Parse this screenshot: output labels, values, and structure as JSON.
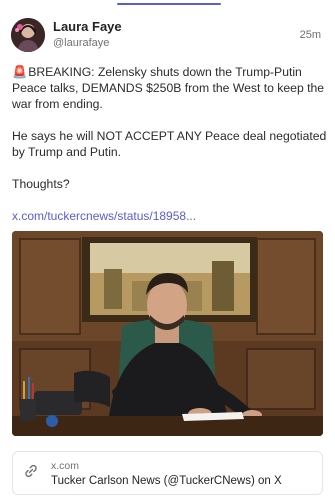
{
  "header": {
    "author_name": "Laura Faye",
    "author_handle": "@laurafaye",
    "timestamp": "25m"
  },
  "post": {
    "alert_icon": "🚨",
    "paragraph_1": "BREAKING: Zelensky shuts down the Trump-Putin Peace talks, DEMANDS $250B from the West to keep the war from ending.",
    "paragraph_2": "He says he will NOT ACCEPT ANY Peace deal negotiated by Trump and Putin.",
    "paragraph_3": "Thoughts?",
    "link_text": "x.com/tuckercnews/status/18958..."
  },
  "link_card": {
    "domain": "x.com",
    "title": "Tucker Carlson News (@TuckerCNews) on X",
    "icon": "link-icon"
  },
  "colors": {
    "accent": "#5b5bd6",
    "text": "#2b2b30",
    "muted": "#6f6f78",
    "border": "#e4e4ea"
  }
}
